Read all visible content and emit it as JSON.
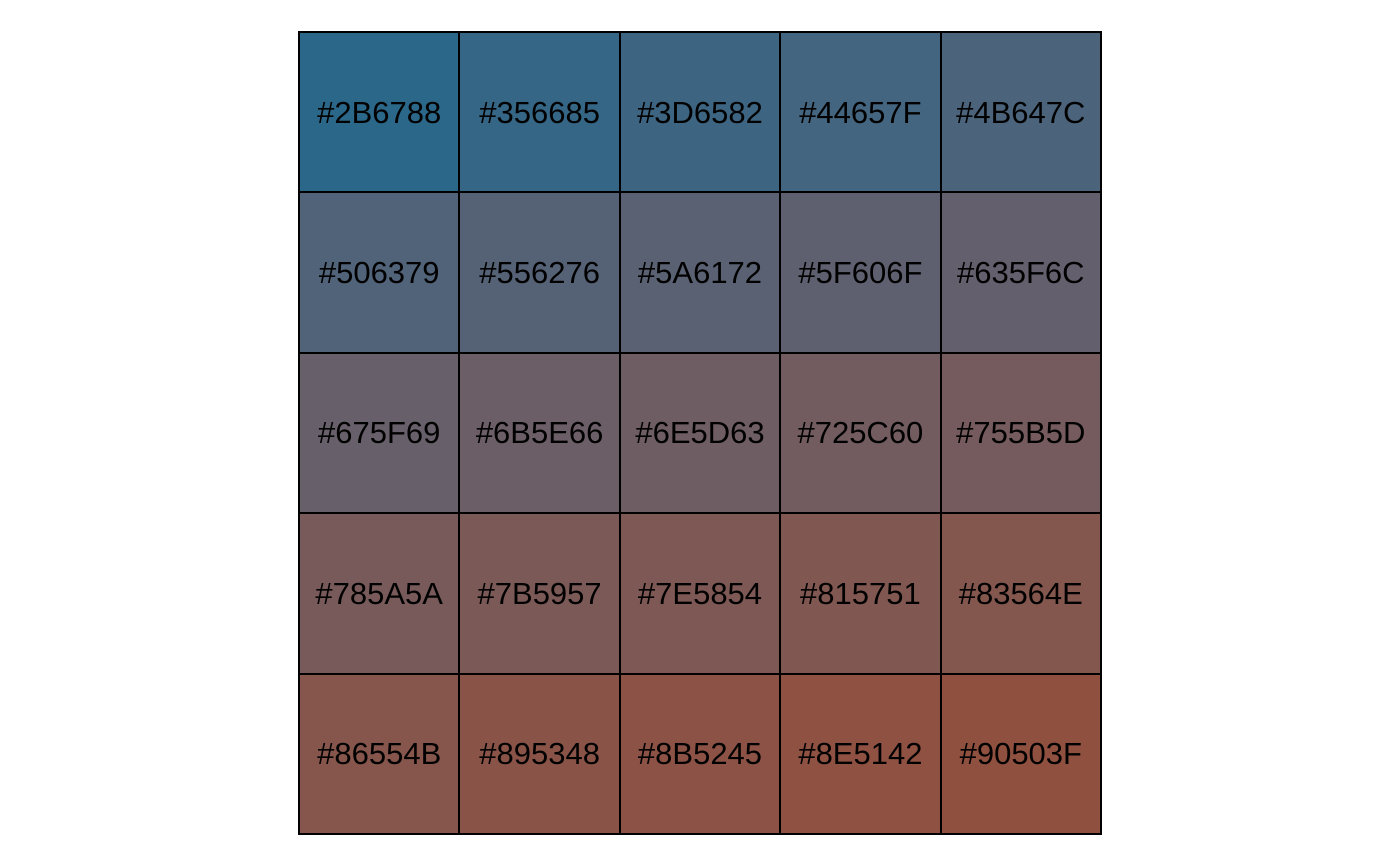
{
  "swatches": [
    {
      "label": "#2B6788",
      "color": "#2B6788"
    },
    {
      "label": "#356685",
      "color": "#356685"
    },
    {
      "label": "#3D6582",
      "color": "#3D6582"
    },
    {
      "label": "#44657F",
      "color": "#44657F"
    },
    {
      "label": "#4B647C",
      "color": "#4B647C"
    },
    {
      "label": "#506379",
      "color": "#506379"
    },
    {
      "label": "#556276",
      "color": "#556276"
    },
    {
      "label": "#5A6172",
      "color": "#5A6172"
    },
    {
      "label": "#5F606F",
      "color": "#5F606F"
    },
    {
      "label": "#635F6C",
      "color": "#635F6C"
    },
    {
      "label": "#675F69",
      "color": "#675F69"
    },
    {
      "label": "#6B5E66",
      "color": "#6B5E66"
    },
    {
      "label": "#6E5D63",
      "color": "#6E5D63"
    },
    {
      "label": "#725C60",
      "color": "#725C60"
    },
    {
      "label": "#755B5D",
      "color": "#755B5D"
    },
    {
      "label": "#785A5A",
      "color": "#785A5A"
    },
    {
      "label": "#7B5957",
      "color": "#7B5957"
    },
    {
      "label": "#7E5854",
      "color": "#7E5854"
    },
    {
      "label": "#815751",
      "color": "#815751"
    },
    {
      "label": "#83564E",
      "color": "#83564E"
    },
    {
      "label": "#86554B",
      "color": "#86554B"
    },
    {
      "label": "#895348",
      "color": "#895348"
    },
    {
      "label": "#8B5245",
      "color": "#8B5245"
    },
    {
      "label": "#8E5142",
      "color": "#8E5142"
    },
    {
      "label": "#90503F",
      "color": "#90503F"
    }
  ]
}
